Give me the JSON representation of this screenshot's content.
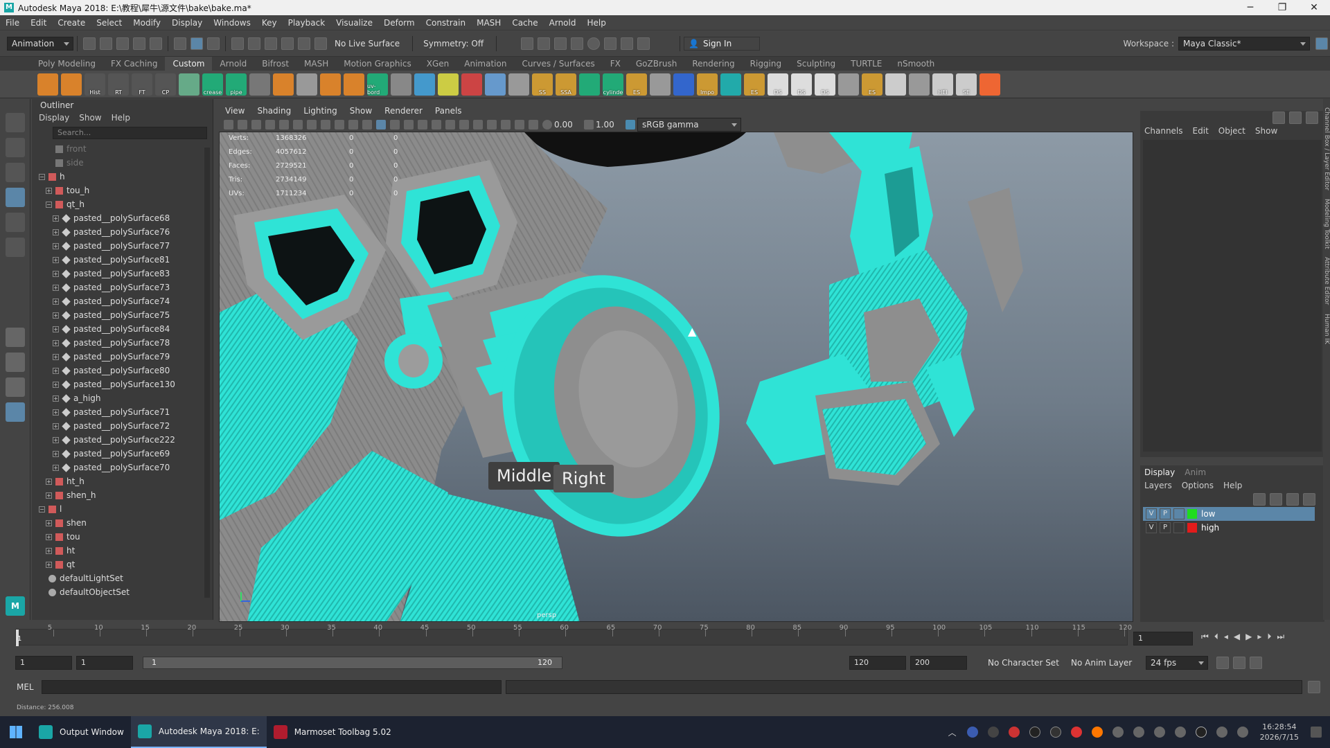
{
  "window": {
    "title": "Autodesk Maya 2018: E:\\教程\\犀牛\\源文件\\bake\\bake.ma*",
    "min": "─",
    "max": "❐",
    "close": "✕"
  },
  "menubar": [
    "File",
    "Edit",
    "Create",
    "Select",
    "Modify",
    "Display",
    "Windows",
    "Key",
    "Playback",
    "Visualize",
    "Deform",
    "Constrain",
    "MASH",
    "Cache",
    "Arnold",
    "Help"
  ],
  "statusline": {
    "mode": "Animation",
    "live_surface": "No Live Surface",
    "symmetry": "Symmetry: Off",
    "sign_in": "Sign In",
    "workspace_label": "Workspace :",
    "workspace": "Maya Classic*"
  },
  "shelf_tabs": [
    "Poly Modeling",
    "FX Caching",
    "Custom",
    "Arnold",
    "Bifrost",
    "MASH",
    "Motion Graphics",
    "XGen",
    "Animation",
    "Curves / Surfaces",
    "FX",
    "GoZBrush",
    "Rendering",
    "Rigging",
    "Sculpting",
    "TURTLE",
    "nSmooth"
  ],
  "shelf_tab_active": "Custom",
  "shelf_icons": [
    {
      "label": "",
      "color": "#d9822b"
    },
    {
      "label": "",
      "color": "#d9822b"
    },
    {
      "label": "Hist",
      "color": "#555"
    },
    {
      "label": "RT",
      "color": "#555"
    },
    {
      "label": "FT",
      "color": "#555"
    },
    {
      "label": "CP",
      "color": "#555"
    },
    {
      "label": "",
      "color": "#6a8"
    },
    {
      "label": "crease",
      "color": "#2a7"
    },
    {
      "label": "pipe",
      "color": "#2a7"
    },
    {
      "label": "",
      "color": "#777"
    },
    {
      "label": "",
      "color": "#d9822b"
    },
    {
      "label": "",
      "color": "#999"
    },
    {
      "label": "",
      "color": "#d9822b"
    },
    {
      "label": "",
      "color": "#d9822b"
    },
    {
      "label": "uv-bord",
      "color": "#2a7"
    },
    {
      "label": "",
      "color": "#888"
    },
    {
      "label": "",
      "color": "#49c"
    },
    {
      "label": "",
      "color": "#cc4"
    },
    {
      "label": "",
      "color": "#c44"
    },
    {
      "label": "",
      "color": "#69c"
    },
    {
      "label": "",
      "color": "#999"
    },
    {
      "label": "SS",
      "color": "#c93"
    },
    {
      "label": "SSA",
      "color": "#c93"
    },
    {
      "label": "",
      "color": "#2a7"
    },
    {
      "label": "cylinde",
      "color": "#2a7"
    },
    {
      "label": "ES",
      "color": "#c93"
    },
    {
      "label": "",
      "color": "#999"
    },
    {
      "label": "",
      "color": "#36c"
    },
    {
      "label": "Impo",
      "color": "#c93"
    },
    {
      "label": "",
      "color": "#2aa"
    },
    {
      "label": "ES",
      "color": "#c93"
    },
    {
      "label": "DS",
      "color": "#ddd"
    },
    {
      "label": "DS",
      "color": "#ddd"
    },
    {
      "label": "DS",
      "color": "#ddd"
    },
    {
      "label": "",
      "color": "#999"
    },
    {
      "label": "ES",
      "color": "#c93"
    },
    {
      "label": "",
      "color": "#ccc"
    },
    {
      "label": "",
      "color": "#999"
    },
    {
      "label": "HEI",
      "color": "#ccc"
    },
    {
      "label": "SE",
      "color": "#ccc"
    },
    {
      "label": "",
      "color": "#e63"
    }
  ],
  "outliner": {
    "title": "Outliner",
    "menu": [
      "Display",
      "Show",
      "Help"
    ],
    "search_placeholder": "Search...",
    "rows": [
      {
        "label": "front",
        "depth": 1,
        "icon": "camera",
        "expander": "",
        "dim": true
      },
      {
        "label": "side",
        "depth": 1,
        "icon": "camera",
        "expander": "",
        "dim": true
      },
      {
        "label": "h",
        "depth": 0,
        "icon": "group",
        "expander": "−",
        "dim": false
      },
      {
        "label": "tou_h",
        "depth": 1,
        "icon": "group",
        "expander": "+",
        "dim": false
      },
      {
        "label": "qt_h",
        "depth": 1,
        "icon": "group",
        "expander": "−",
        "dim": false
      },
      {
        "label": "pasted__polySurface68",
        "depth": 2,
        "icon": "mesh",
        "expander": "+",
        "dim": false
      },
      {
        "label": "pasted__polySurface76",
        "depth": 2,
        "icon": "mesh",
        "expander": "+",
        "dim": false
      },
      {
        "label": "pasted__polySurface77",
        "depth": 2,
        "icon": "mesh",
        "expander": "+",
        "dim": false
      },
      {
        "label": "pasted__polySurface81",
        "depth": 2,
        "icon": "mesh",
        "expander": "+",
        "dim": false
      },
      {
        "label": "pasted__polySurface83",
        "depth": 2,
        "icon": "mesh",
        "expander": "+",
        "dim": false
      },
      {
        "label": "pasted__polySurface73",
        "depth": 2,
        "icon": "mesh",
        "expander": "+",
        "dim": false
      },
      {
        "label": "pasted__polySurface74",
        "depth": 2,
        "icon": "mesh",
        "expander": "+",
        "dim": false
      },
      {
        "label": "pasted__polySurface75",
        "depth": 2,
        "icon": "mesh",
        "expander": "+",
        "dim": false
      },
      {
        "label": "pasted__polySurface84",
        "depth": 2,
        "icon": "mesh",
        "expander": "+",
        "dim": false
      },
      {
        "label": "pasted__polySurface78",
        "depth": 2,
        "icon": "mesh",
        "expander": "+",
        "dim": false
      },
      {
        "label": "pasted__polySurface79",
        "depth": 2,
        "icon": "mesh",
        "expander": "+",
        "dim": false
      },
      {
        "label": "pasted__polySurface80",
        "depth": 2,
        "icon": "mesh",
        "expander": "+",
        "dim": false
      },
      {
        "label": "pasted__polySurface130",
        "depth": 2,
        "icon": "mesh",
        "expander": "+",
        "dim": false
      },
      {
        "label": "a_high",
        "depth": 2,
        "icon": "mesh",
        "expander": "+",
        "dim": false
      },
      {
        "label": "pasted__polySurface71",
        "depth": 2,
        "icon": "mesh",
        "expander": "+",
        "dim": false
      },
      {
        "label": "pasted__polySurface72",
        "depth": 2,
        "icon": "mesh",
        "expander": "+",
        "dim": false
      },
      {
        "label": "pasted__polySurface222",
        "depth": 2,
        "icon": "mesh",
        "expander": "+",
        "dim": false
      },
      {
        "label": "pasted__polySurface69",
        "depth": 2,
        "icon": "mesh",
        "expander": "+",
        "dim": false
      },
      {
        "label": "pasted__polySurface70",
        "depth": 2,
        "icon": "mesh",
        "expander": "+",
        "dim": false
      },
      {
        "label": "ht_h",
        "depth": 1,
        "icon": "group",
        "expander": "+",
        "dim": false
      },
      {
        "label": "shen_h",
        "depth": 1,
        "icon": "group",
        "expander": "+",
        "dim": false
      },
      {
        "label": "l",
        "depth": 0,
        "icon": "group",
        "expander": "−",
        "dim": false
      },
      {
        "label": "shen",
        "depth": 1,
        "icon": "group",
        "expander": "+",
        "dim": false
      },
      {
        "label": "tou",
        "depth": 1,
        "icon": "group",
        "expander": "+",
        "dim": false
      },
      {
        "label": "ht",
        "depth": 1,
        "icon": "group",
        "expander": "+",
        "dim": false
      },
      {
        "label": "qt",
        "depth": 1,
        "icon": "group",
        "expander": "+",
        "dim": false
      },
      {
        "label": "defaultLightSet",
        "depth": 0,
        "icon": "set",
        "expander": "",
        "dim": false
      },
      {
        "label": "defaultObjectSet",
        "depth": 0,
        "icon": "set",
        "expander": "",
        "dim": false
      }
    ]
  },
  "viewport": {
    "menu": [
      "View",
      "Shading",
      "Lighting",
      "Show",
      "Renderer",
      "Panels"
    ],
    "exposure": "0.00",
    "gamma": "1.00",
    "colorspace": "sRGB gamma",
    "camera": "persp",
    "hud": [
      {
        "name": "Verts:",
        "v1": "1368326",
        "v2": "0",
        "v3": "0"
      },
      {
        "name": "Edges:",
        "v1": "4057612",
        "v2": "0",
        "v3": "0"
      },
      {
        "name": "Faces:",
        "v1": "2729521",
        "v2": "0",
        "v3": "0"
      },
      {
        "name": "Tris:",
        "v1": "2734149",
        "v2": "0",
        "v3": "0"
      },
      {
        "name": "UVs:",
        "v1": "1711234",
        "v2": "0",
        "v3": "0"
      }
    ],
    "mouse_labels": {
      "middle": "Middle",
      "right": "Right"
    },
    "teal": "#2fe3d6",
    "gray": "#8e8e8e"
  },
  "channelbox": {
    "menu": [
      "Channels",
      "Edit",
      "Object",
      "Show"
    ],
    "side_tabs": [
      "Channel Box / Layer Editor",
      "Modeling Toolkit",
      "Attribute Editor",
      "Human IK"
    ]
  },
  "layers": {
    "tabs": [
      "Display",
      "Anim"
    ],
    "menu": [
      "Layers",
      "Options",
      "Help"
    ],
    "rows": [
      {
        "v": "V",
        "p": "P",
        "color": "#1fdc1f",
        "name": "low",
        "selected": true
      },
      {
        "v": "V",
        "p": "P",
        "color": "#e21b1b",
        "name": "high",
        "selected": false
      }
    ]
  },
  "timeslider": {
    "ticks": [
      "5",
      "10",
      "15",
      "20",
      "25",
      "30",
      "35",
      "40",
      "45",
      "50",
      "55",
      "60",
      "65",
      "70",
      "75",
      "80",
      "85",
      "90",
      "95",
      "100",
      "105",
      "110",
      "115",
      "120"
    ],
    "current_frame": "1",
    "current_frame_field": "1"
  },
  "rangeslider": {
    "start": "1",
    "anim_start": "1",
    "range_start": "1",
    "range_end": "120",
    "end": "120",
    "anim_end": "200",
    "character_set": "No Character Set",
    "anim_layer": "No Anim Layer",
    "fps": "24 fps"
  },
  "cmdline": {
    "label": "MEL"
  },
  "helpline": {
    "text": "Distance:   256.008"
  },
  "taskbar": {
    "items": [
      {
        "label": "Output Window",
        "active": false
      },
      {
        "label": "Autodesk Maya 2018: E:",
        "active": true
      },
      {
        "label": "Marmoset Toolbag 5.02",
        "active": false
      }
    ],
    "time": "16:28:54",
    "date": "2026/7/15"
  }
}
